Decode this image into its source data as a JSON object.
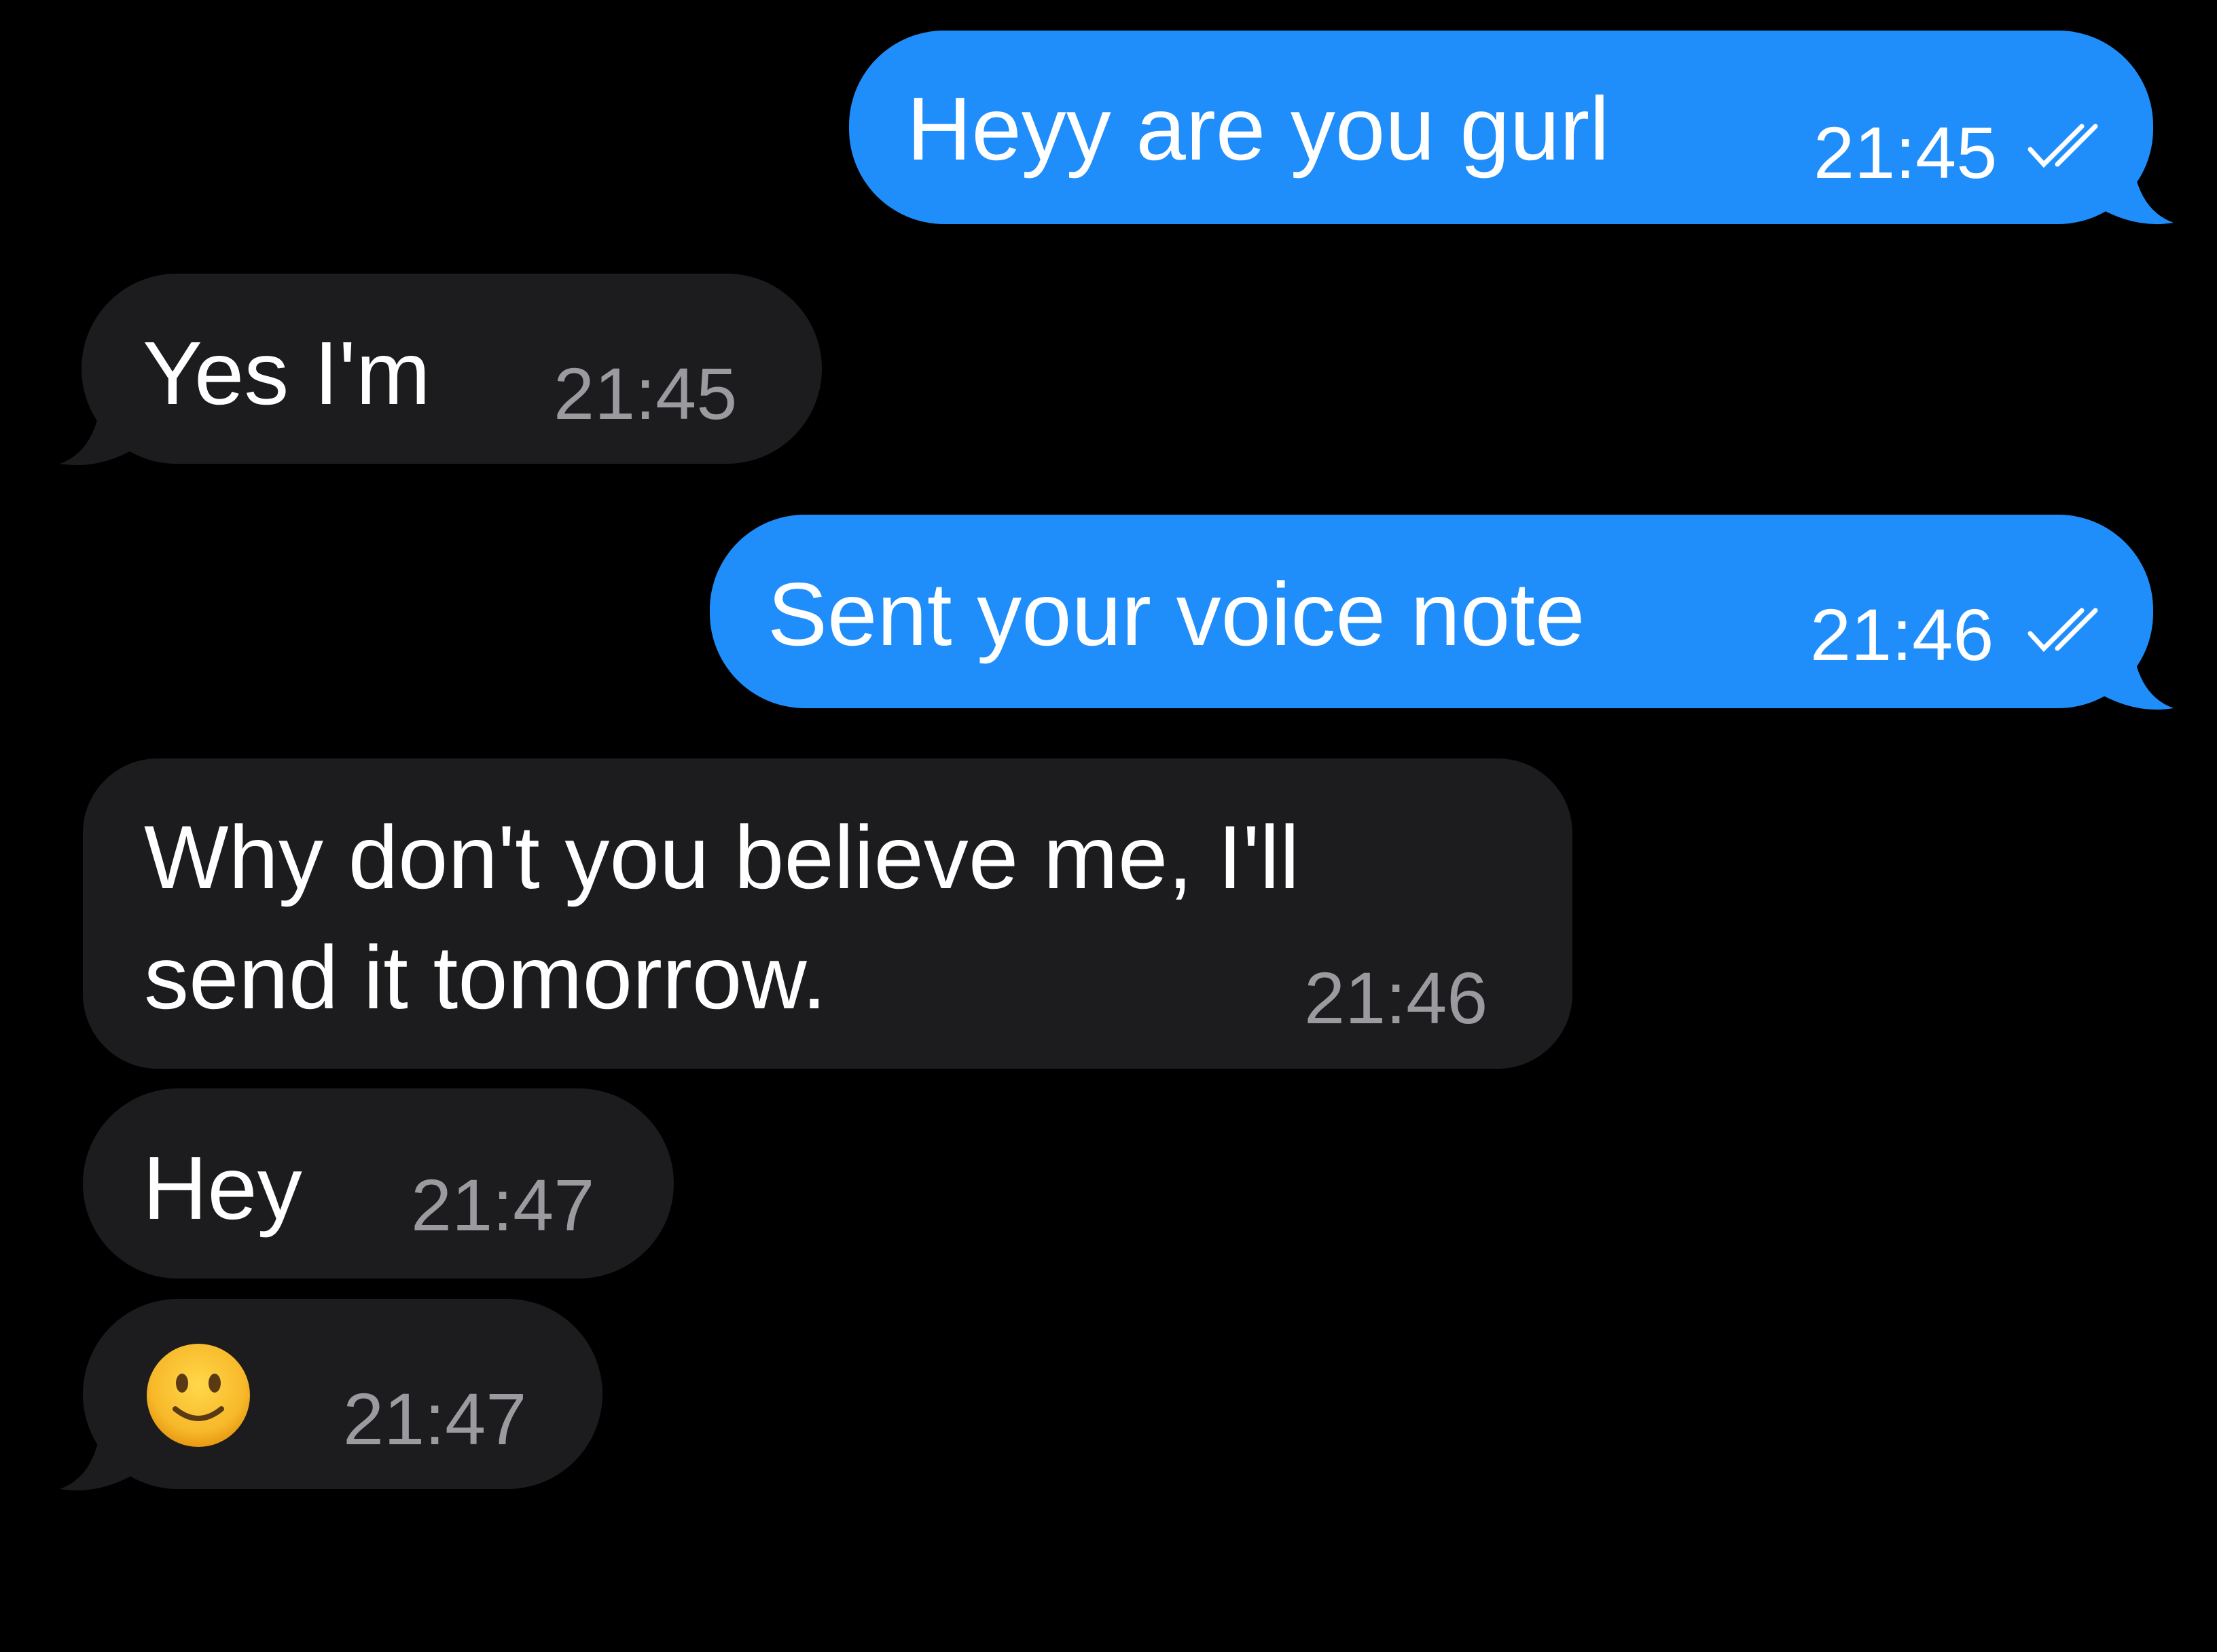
{
  "theme": {
    "background": "#000000",
    "outgoing_bubble": "#1f8efa",
    "incoming_bubble": "#1c1c1e",
    "incoming_time_color": "#9a9a9f"
  },
  "messages": [
    {
      "direction": "outgoing",
      "text": "Heyy are you gurl",
      "time": "21:45",
      "status_icon": "double-check-icon"
    },
    {
      "direction": "incoming",
      "text": "Yes I'm",
      "time": "21:45"
    },
    {
      "direction": "outgoing",
      "text": "Sent your voice note",
      "time": "21:46",
      "status_icon": "double-check-icon"
    },
    {
      "direction": "incoming",
      "text_lines": [
        "Why don't you believe me, I'll",
        "send it tomorrow."
      ],
      "time": "21:46"
    },
    {
      "direction": "incoming",
      "text": "Hey",
      "time": "21:47"
    },
    {
      "direction": "incoming",
      "emoji": "slightly-smiling-face-icon",
      "time": "21:47"
    }
  ]
}
